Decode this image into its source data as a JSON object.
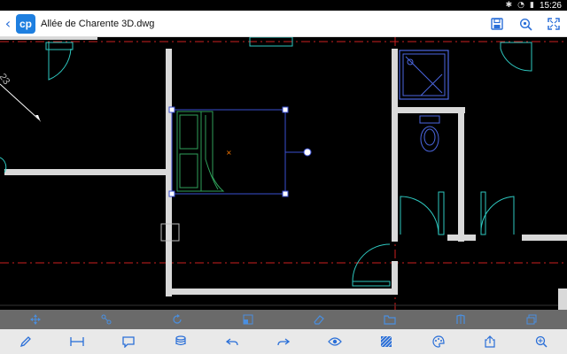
{
  "status_bar": {
    "time": "15:26",
    "icons": [
      "bluetooth-icon",
      "wifi-icon",
      "battery-icon"
    ]
  },
  "app_bar": {
    "back_icon": "chevron-left-icon",
    "logo_glyph": "cp",
    "file_name": "Allée de Charente 3D.dwg",
    "actions": [
      "save-icon",
      "zoom-search-icon",
      "fullscreen-icon"
    ]
  },
  "drawing": {
    "dimension_text": "23",
    "colors": {
      "background": "#000000",
      "wall": "#d9d9d9",
      "grid_line": "#cc1f1f",
      "selection": "#3a4fd0",
      "furniture": "#2fa05a",
      "fixtures": "#4b66e0",
      "doors": "#2ec8c0",
      "marker": "#ff7a00"
    }
  },
  "toolbar_top": {
    "tools": [
      "move-icon",
      "snap-icon",
      "rotate-icon",
      "scale-icon",
      "erase-icon",
      "folder-icon",
      "layers-icon",
      "properties-icon"
    ]
  },
  "toolbar_bottom": {
    "tools": [
      "pencil-icon",
      "measure-icon",
      "comment-icon",
      "layers-stack-icon",
      "undo-icon",
      "redo-icon",
      "eye-icon",
      "hatch-icon",
      "palette-icon",
      "share-icon",
      "zoom-icon"
    ]
  }
}
